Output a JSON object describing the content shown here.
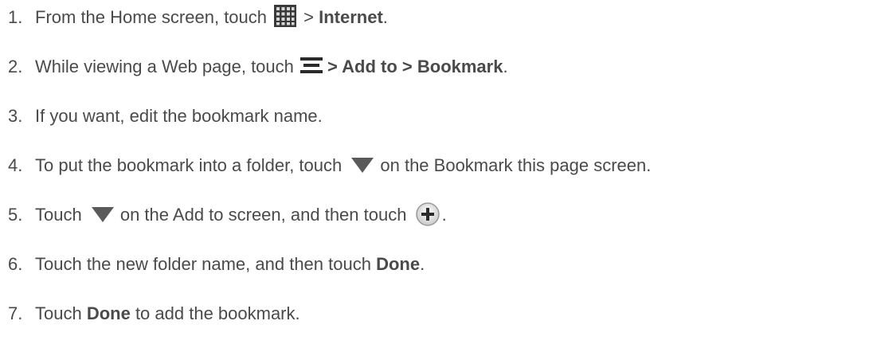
{
  "steps": [
    {
      "num": "1.",
      "parts": [
        "From the Home screen, touch",
        "> ",
        "Internet",
        "."
      ]
    },
    {
      "num": "2.",
      "parts": [
        "While viewing a Web page, touch",
        "> Add to > Bookmark",
        "."
      ]
    },
    {
      "num": "3.",
      "parts": [
        "If you want, edit the bookmark name."
      ]
    },
    {
      "num": "4.",
      "parts": [
        "To put the bookmark into a folder, touch",
        "on the Bookmark this page screen."
      ]
    },
    {
      "num": "5.",
      "parts": [
        "Touch",
        "on the Add to screen, and then touch",
        "."
      ]
    },
    {
      "num": "6.",
      "parts": [
        "Touch the new folder name, and then touch ",
        "Done",
        "."
      ]
    },
    {
      "num": "7.",
      "parts": [
        "Touch ",
        "Done",
        " to add the bookmark."
      ]
    }
  ],
  "icons": {
    "apps": "apps-grid-icon",
    "menu": "menu-icon",
    "dropdown": "dropdown-triangle-icon",
    "add": "plus-circle-icon"
  },
  "colors": {
    "text": "#4a4a4a",
    "icon_dark": "#2b2b2b",
    "triangle": "#5a5a5a"
  }
}
